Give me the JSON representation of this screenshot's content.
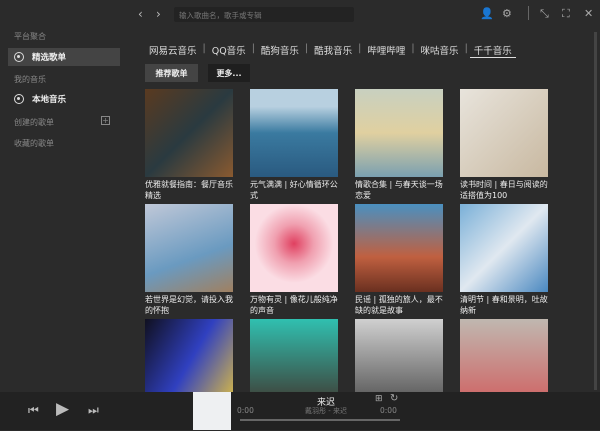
{
  "search": {
    "placeholder": "输入歌曲名，歌手或专辑"
  },
  "sidebar": {
    "platform": "平台聚合",
    "featured": "精选歌单",
    "my_music": "我的音乐",
    "local": "本地音乐",
    "created": "创建的歌单",
    "collected": "收藏的歌单"
  },
  "tabs": [
    "网易云音乐",
    "QQ音乐",
    "酷狗音乐",
    "酷我音乐",
    "哔哩哔哩",
    "咪咕音乐",
    "千千音乐"
  ],
  "buttons": {
    "recommended": "推荐歌单",
    "more": "更多..."
  },
  "playlists": [
    {
      "title": "优雅就餐指南：餐厅音乐精选",
      "color": "linear-gradient(135deg,#5a3a20,#2a3a40 50%,#8a5a30)"
    },
    {
      "title": "元气满满 | 好心情循环公式",
      "color": "linear-gradient(180deg,#b8d0e0 20%,#3a7aa0 50%,#2a5a80)"
    },
    {
      "title": "情歌合集 | 与春天谈一场恋爱",
      "color": "linear-gradient(180deg,#c8d0c0,#e0d0a0 50%,#7aa0b0)"
    },
    {
      "title": "读书时间 | 春日与阅读的适搭值为100",
      "color": "linear-gradient(135deg,#e8e4dc,#c8b8a0)"
    },
    {
      "title": "若世界是幻觉，请投入我的怀抱",
      "color": "linear-gradient(160deg,#c0c8d8,#6a9ac0 60%,#a08060)"
    },
    {
      "title": "万物有灵 | 像花儿般纯净的声音",
      "color": "radial-gradient(circle at 50% 45%,#e04060 0,#f0a0b0 30%,#fbdde4 60%)"
    },
    {
      "title": "民谣 | 孤独的旅人，最不缺的就是故事",
      "color": "linear-gradient(180deg,#4a90c0,#c06040 60%,#6a3020)"
    },
    {
      "title": "清明节 | 春和景明，吐故纳新",
      "color": "linear-gradient(135deg,#7ab0d8,#e0e8f0 50%,#4a88c0)"
    },
    {
      "title": "",
      "color": "linear-gradient(120deg,#101020,#3040c0 50%,#e0c040)"
    },
    {
      "title": "",
      "color": "linear-gradient(180deg,#30c0b0,#403830)"
    },
    {
      "title": "",
      "color": "linear-gradient(180deg,#d0d0d0,#505050)"
    },
    {
      "title": "",
      "color": "linear-gradient(180deg,#c0b8b0,#d06060)"
    }
  ],
  "player": {
    "song": "来迟",
    "artist": "戴羽彤 - 来迟",
    "current": "0:00",
    "total": "0:00",
    "progress": 0
  }
}
